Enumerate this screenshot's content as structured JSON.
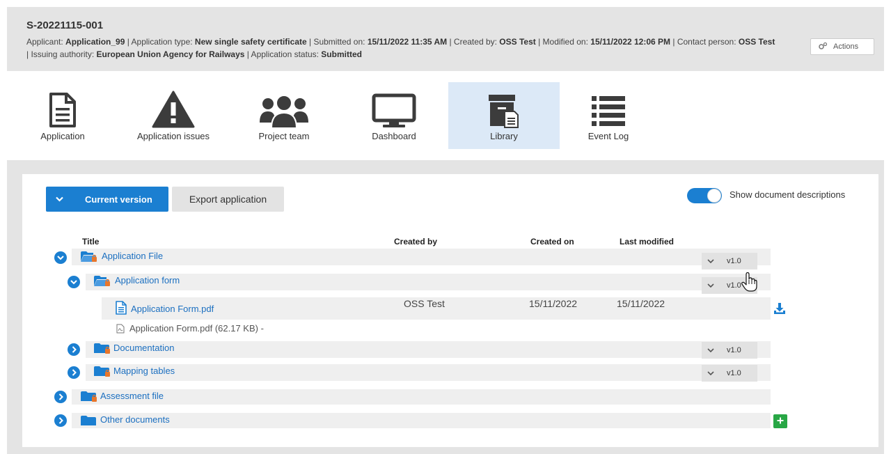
{
  "header": {
    "case_id": "S-20221115-001",
    "meta": [
      {
        "k": "Applicant: ",
        "v": "Application_99"
      },
      {
        "k": " | Application type: ",
        "v": "New single safety certificate"
      },
      {
        "k": " | Submitted on: ",
        "v": "15/11/2022 11:35 AM"
      },
      {
        "k": " | Created by: ",
        "v": "OSS Test"
      },
      {
        "k": " | Modified on: ",
        "v": "15/11/2022 12:06 PM"
      },
      {
        "k": " | Contact person: ",
        "v": "OSS Test"
      },
      {
        "k": " | Issuing authority: ",
        "v": "European Union Agency for Railways"
      },
      {
        "k": " | Application status: ",
        "v": "Submitted"
      }
    ],
    "actions_label": "Actions"
  },
  "nav": {
    "application": "Application",
    "issues": "Application issues",
    "team": "Project team",
    "dashboard": "Dashboard",
    "library": "Library",
    "eventlog": "Event Log"
  },
  "toolbar": {
    "current_version": "Current version",
    "export": "Export application",
    "show_descriptions": "Show document descriptions",
    "show_descriptions_on": true
  },
  "table": {
    "headers": {
      "title": "Title",
      "created_by": "Created by",
      "created_on": "Created on",
      "last_modified": "Last modified"
    },
    "application_file": {
      "title": "Application File",
      "version": "v1.0"
    },
    "application_form": {
      "title": "Application form",
      "version": "v1.0"
    },
    "form_pdf": {
      "title": "Application Form.pdf",
      "created_by": "OSS Test",
      "created_on": "15/11/2022",
      "last_modified": "15/11/2022",
      "attachment": "Application Form.pdf (62.17 KB) -"
    },
    "documentation": {
      "title": "Documentation",
      "version": "v1.0"
    },
    "mapping_tables": {
      "title": "Mapping tables",
      "version": "v1.0"
    },
    "assessment_file": {
      "title": "Assessment file"
    },
    "other_documents": {
      "title": "Other documents"
    }
  },
  "colors": {
    "primary": "#1b7fd1",
    "folder": "#1b7fd1",
    "lock": "#e8762b",
    "add": "#28a745",
    "icon_dark": "#3c3c3c"
  }
}
